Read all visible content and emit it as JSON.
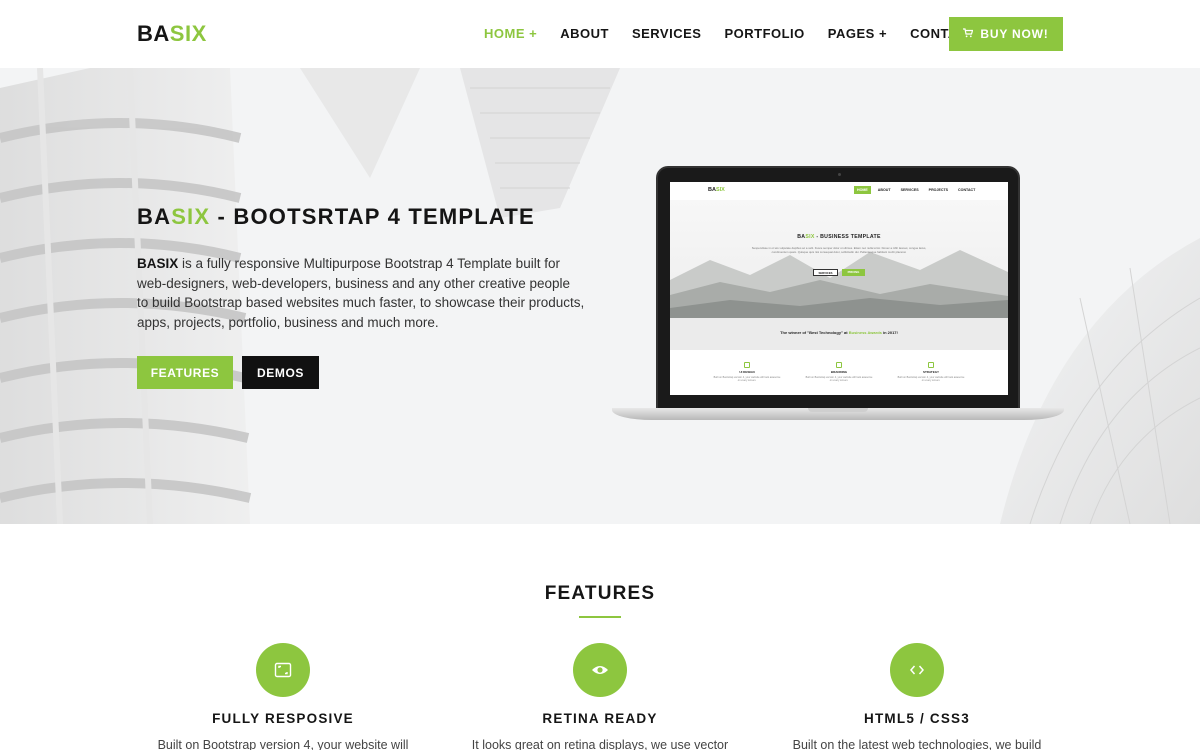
{
  "brand": {
    "logo_dark": "BA",
    "logo_green": "SIX"
  },
  "colors": {
    "accent": "#8dc63f",
    "dark": "#151515",
    "hero_bg": "#f3f4f5"
  },
  "nav": {
    "items": [
      {
        "label": "HOME +",
        "active": true
      },
      {
        "label": "ABOUT",
        "active": false
      },
      {
        "label": "SERVICES",
        "active": false
      },
      {
        "label": "PORTFOLIO",
        "active": false
      },
      {
        "label": "PAGES +",
        "active": false
      },
      {
        "label": "CONTACT",
        "active": false
      }
    ],
    "buy_label": "BUY NOW!",
    "buy_icon": "cart-icon"
  },
  "hero": {
    "title_dark1": "BA",
    "title_green": "SIX",
    "title_rest": " - BOOTSRTAP 4 TEMPLATE",
    "desc_bold": "BASIX",
    "desc_rest": " is a fully responsive Multipurpose Bootstrap 4 Template built for web-designers, web-developers, business and any other creative people to build Bootstrap based websites much faster, to showcase their products, apps, projects, portfolio, business and much more.",
    "btn_features": "FEATURES",
    "btn_demos": "DEMOS"
  },
  "preview": {
    "logo_dark": "BA",
    "logo_green": "SIX",
    "links": [
      "HOME",
      "ABOUT",
      "SERVICES",
      "PROJECTS",
      "CONTACT"
    ],
    "title_dark": "BA",
    "title_green": "SIX",
    "title_rest": " - BUSINESS TEMPLATE",
    "text": "Suspendisse in ot wis vulputate dapibus ac a velit. Fusce semper dolor ut ultrices. Etiam nec nulla tortor. Donec a nibh laoreet, congue lacus, condimentum quam. Quisque quis nisi consequat dolor, sollicitudin dui. Pellentesque habitant morbi placerat.",
    "btn1": "SERVICES",
    "btn2": "PRICING",
    "band_text": "The winner of \"Best Technology\" at ",
    "band_green": "Business Awards",
    "band_end": " in 2017!",
    "features": [
      {
        "title": "UI DESIGN",
        "text": "Built on Bootstrap version 4, your website will look awesome on every screen."
      },
      {
        "title": "BRANDING",
        "text": "Built on Bootstrap version 4, your website will look awesome on every screen."
      },
      {
        "title": "STRATEGY",
        "text": "Built on Bootstrap version 4, your website will look awesome on every screen."
      }
    ]
  },
  "features": {
    "title": "FEATURES",
    "items": [
      {
        "icon": "responsive-icon",
        "name": "FULLY RESPOSIVE",
        "desc": "Built on Bootstrap version 4, your website will"
      },
      {
        "icon": "eye-icon",
        "name": "RETINA READY",
        "desc": "It looks great on retina displays, we use vector"
      },
      {
        "icon": "code-icon",
        "name": "HTML5 / CSS3",
        "desc": "Built on the latest web technologies, we build"
      }
    ]
  }
}
